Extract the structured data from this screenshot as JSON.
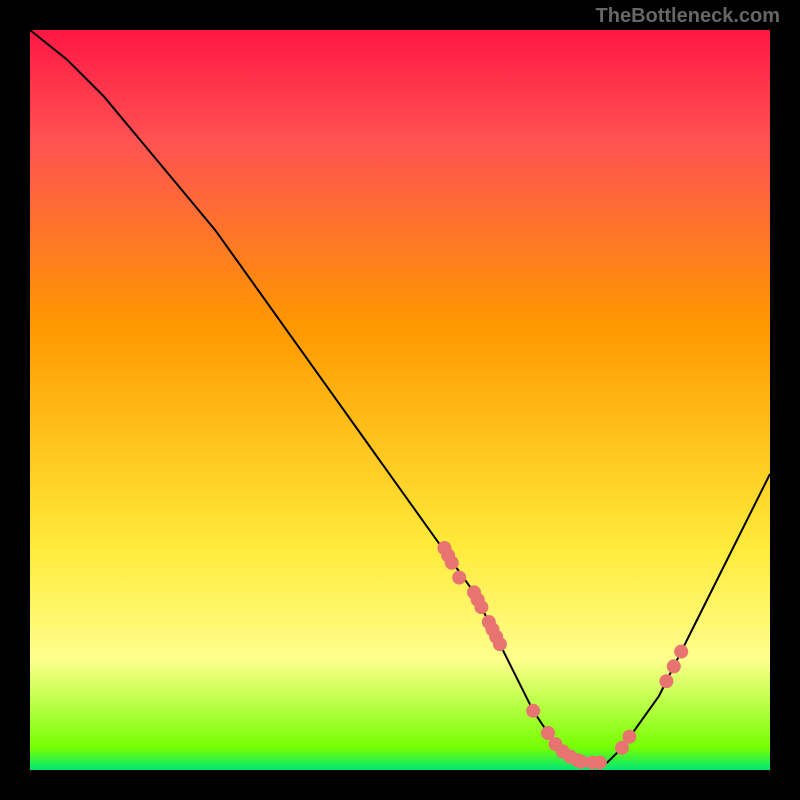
{
  "watermark": "TheBottleneck.com",
  "chart_data": {
    "type": "line",
    "title": "",
    "xlabel": "",
    "ylabel": "",
    "xlim": [
      0,
      100
    ],
    "ylim": [
      0,
      100
    ],
    "curve": {
      "x": [
        0,
        5,
        10,
        15,
        20,
        25,
        30,
        35,
        40,
        45,
        50,
        55,
        60,
        62,
        65,
        68,
        70,
        72,
        75,
        78,
        80,
        85,
        90,
        95,
        100
      ],
      "y": [
        100,
        96,
        91,
        85,
        79,
        73,
        66,
        59,
        52,
        45,
        38,
        31,
        24,
        20,
        14,
        8,
        5,
        3,
        1,
        1,
        3,
        10,
        20,
        30,
        40
      ]
    },
    "scatter_points": [
      {
        "x": 56,
        "y": 30
      },
      {
        "x": 56.5,
        "y": 29
      },
      {
        "x": 57,
        "y": 28
      },
      {
        "x": 58,
        "y": 26
      },
      {
        "x": 60,
        "y": 24
      },
      {
        "x": 60.5,
        "y": 23
      },
      {
        "x": 61,
        "y": 22
      },
      {
        "x": 62,
        "y": 20
      },
      {
        "x": 62.5,
        "y": 19
      },
      {
        "x": 63,
        "y": 18
      },
      {
        "x": 63.5,
        "y": 17
      },
      {
        "x": 68,
        "y": 8
      },
      {
        "x": 70,
        "y": 5
      },
      {
        "x": 71,
        "y": 3.5
      },
      {
        "x": 72,
        "y": 2.5
      },
      {
        "x": 73,
        "y": 1.8
      },
      {
        "x": 74,
        "y": 1.3
      },
      {
        "x": 74.5,
        "y": 1.1
      },
      {
        "x": 76,
        "y": 1
      },
      {
        "x": 77,
        "y": 1
      },
      {
        "x": 80,
        "y": 3
      },
      {
        "x": 81,
        "y": 4.5
      },
      {
        "x": 86,
        "y": 12
      },
      {
        "x": 87,
        "y": 14
      },
      {
        "x": 88,
        "y": 16
      }
    ],
    "gradient_colors": {
      "top": "#ff1744",
      "mid_upper": "#ff9800",
      "mid_lower": "#ffeb3b",
      "bottom": "#00e676"
    }
  }
}
